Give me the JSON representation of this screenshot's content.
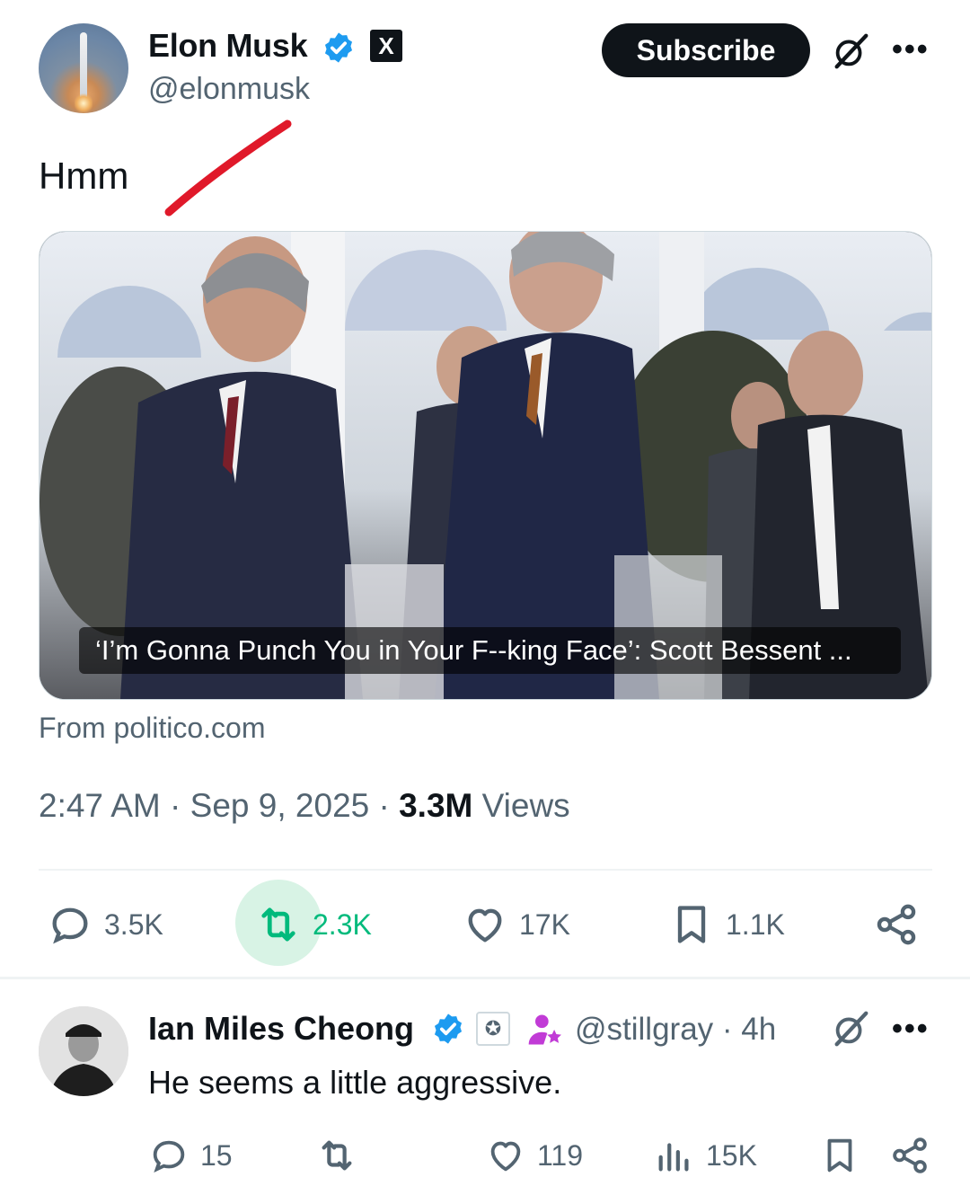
{
  "post": {
    "author": {
      "name": "Elon Musk",
      "handle": "@elonmusk",
      "verified_icon": "verified-badge-icon",
      "affiliate_badge": "X"
    },
    "subscribe_label": "Subscribe",
    "text": "Hmm",
    "card": {
      "caption": "‘I’m Gonna Punch You in Your F--king Face’: Scott Bessent ...",
      "source": "From politico.com"
    },
    "time": "2:47 AM",
    "date": "Sep 9, 2025",
    "views_count": "3.3M",
    "views_label": "Views",
    "separator": "·",
    "actions": {
      "replies": "3.5K",
      "reposts": "2.3K",
      "likes": "17K",
      "bookmarks": "1.1K"
    },
    "colors": {
      "accent": "#1d9bf0",
      "repost_active": "#00ba7c",
      "annotation": "#e0192a"
    }
  },
  "reply": {
    "author": {
      "name": "Ian Miles Cheong",
      "handle": "@stillgray",
      "time_ago": "· 4h"
    },
    "text": "He seems a little aggressive.",
    "actions": {
      "replies": "15",
      "likes": "119",
      "views": "15K"
    }
  }
}
